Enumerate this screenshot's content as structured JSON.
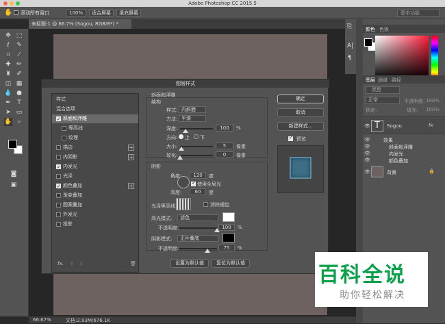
{
  "app": {
    "title": "Adobe Photoshop CC 2015.5"
  },
  "options_bar": {
    "scroll_all_windows": "滚动所有窗口",
    "zoom_pct": "100%",
    "fit_screen": "适合屏幕",
    "fill_screen": "填充屏幕",
    "workspace": "基本功能"
  },
  "document_tab": "未标题-1 @ 66.7% (Sogou, RGB/8*) *",
  "status": {
    "zoom": "66.67%",
    "doc": "文档:2.93M/676.1K"
  },
  "dialog": {
    "title": "图层样式",
    "styles_header": "样式",
    "blend_options": "混合选项",
    "style_items": [
      {
        "label": "斜面和浮雕",
        "checked": true
      },
      {
        "label": "等高线",
        "checked": false
      },
      {
        "label": "纹理",
        "checked": false
      },
      {
        "label": "描边",
        "checked": false
      },
      {
        "label": "内阴影",
        "checked": false
      },
      {
        "label": "内发光",
        "checked": true
      },
      {
        "label": "光泽",
        "checked": false
      },
      {
        "label": "颜色叠加",
        "checked": true
      },
      {
        "label": "渐变叠加",
        "checked": false
      },
      {
        "label": "图案叠加",
        "checked": false
      },
      {
        "label": "外发光",
        "checked": false
      },
      {
        "label": "投影",
        "checked": false
      }
    ],
    "fx_label": "fx.",
    "section_title": "斜面和浮雕",
    "structure": "结构",
    "style_label": "样式:",
    "style_value": "内斜面",
    "method_label": "方法:",
    "method_value": "平滑",
    "depth_label": "深度:",
    "depth_value": "100",
    "depth_unit": "%",
    "direction_label": "方向:",
    "dir_up": "上",
    "dir_down": "下",
    "size_label": "大小:",
    "size_value": "5",
    "size_unit": "像素",
    "soften_label": "软化:",
    "soften_value": "0",
    "soften_unit": "像素",
    "shading": "阴影",
    "angle_label": "角度:",
    "angle_value": "120",
    "angle_unit": "度",
    "global_light": "使用全局光",
    "altitude_label": "高度:",
    "altitude_value": "60",
    "altitude_unit": "度",
    "gloss_label": "光泽等高线:",
    "anti_alias": "消除锯齿",
    "highlight_mode_label": "高光模式:",
    "highlight_mode_value": "滤色",
    "highlight_opacity_label": "不透明度:",
    "highlight_opacity_value": "100",
    "shadow_mode_label": "阴影模式:",
    "shadow_mode_value": "正片叠底",
    "shadow_opacity_label": "不透明度:",
    "shadow_opacity_value": "75",
    "pct": "%",
    "make_default": "设置为默认值",
    "reset_default": "复位为默认值",
    "ok": "确定",
    "cancel": "取消",
    "new_style": "新建样式...",
    "preview": "预览"
  },
  "color_panel": {
    "tab_color": "颜色",
    "tab_swatches": "色板"
  },
  "layers_panel": {
    "tab_layers": "图层",
    "tab_channels": "通道",
    "tab_paths": "路径",
    "kind": "类型",
    "blend": "正常",
    "opacity_label": "不透明度:",
    "opacity_value": "100%",
    "lock_label": "锁定:",
    "fill_label": "填充:",
    "fill_value": "100%",
    "text_layer": "Sogou",
    "effects_label": "效果",
    "effects": [
      "斜面和浮雕",
      "内发光",
      "颜色叠加"
    ],
    "bg_layer": "背景"
  },
  "watermark": {
    "line1": "百科全说",
    "line2": "助你轻松解决"
  },
  "colors": {
    "accent_green": "#0aa14a",
    "preview_blue": "#3e6e86"
  }
}
